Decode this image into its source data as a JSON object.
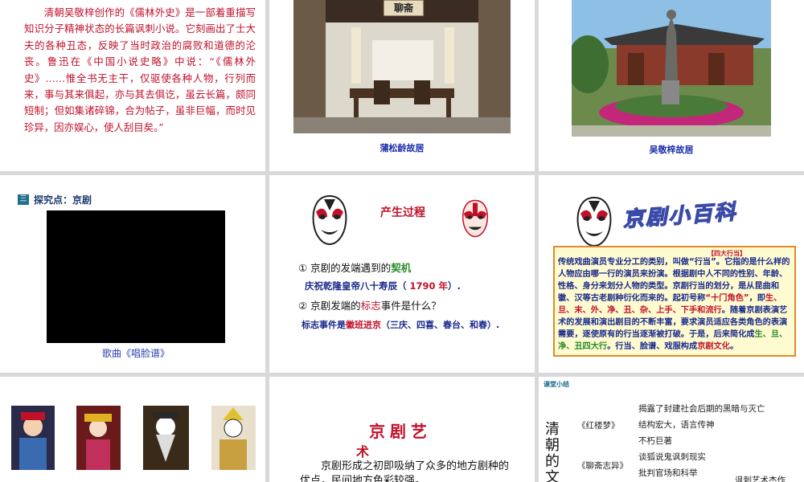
{
  "slide1": {
    "text": "清朝吴敬梓创作的《儒林外史》是一部着重描写知识分子精神状态的长篇讽刺小说。它刻画出了士大夫的各种丑态，反映了当时政治的腐败和道德的沦丧。鲁迅在《中国小说史略》中说：“《儒林外史》……惟全书无主干，仅驱使各种人物，行列而来，事与其来俱起，亦与其去俱讫，虽云长篇，颇同短制；但如集诸碎锦，合为帖子，虽非巨幅，而时见珍异，因亦娱心，使人刮目矣。”"
  },
  "slide2": {
    "plaque": "聊斋",
    "caption": "蒲松龄故居"
  },
  "slide3": {
    "caption": "吴敬梓故居"
  },
  "slide4": {
    "badge": "三",
    "title": "探究点：京剧",
    "video_caption": "歌曲《唱脸谱》"
  },
  "slide5": {
    "title": "产生过程",
    "q1_prefix": "① 京剧的发端遇到的",
    "q1_key": "契机",
    "a1_prefix": "庆祝乾隆皇帝八十寿辰（ ",
    "a1_key": "1790 年",
    "a1_suffix": "）.",
    "q2_prefix": "② 京剧发端的",
    "q2_key": "标志",
    "q2_suffix": "事件是什么？",
    "a2_prefix": "标志事件是",
    "a2_key": "徽班进京",
    "a2_suffix": "（三庆、四喜、春台、和春）."
  },
  "slide6": {
    "wordart": "京剧小百科",
    "tag": "【四大行当】",
    "p1": "传统戏曲演员专业分工的类别，叫做“行当”。它指的是什么样的人物应由哪一行的演员来扮演。根据剧中人不同的性别、年龄、性格、身分来划分人物的类型。京剧行当的划分，是从昆曲和徽、汉等古老剧种衍化而来的。起初号称",
    "k1": "“十门角色”",
    "p2": "，即",
    "k2": "生、旦、末、外、净、丑、杂、上手、下手和流行",
    "p3": "。随着京剧表演艺术的发展和演出剧目的不断丰富，要求演员适应各类角色的表演需要，逐使原有的行当逐渐被打破。于是，后来简化成",
    "k3": "生、旦、净、丑四大行",
    "p4": "。行当、脸谱、戏服构成",
    "k4": "京剧文化",
    "p5": "。"
  },
  "slide8": {
    "title1": "京剧艺",
    "title2": "术",
    "body": "京剧形成之初即吸纳了众多的地方剧种的优点，民间地方色彩较强。"
  },
  "slide9": {
    "tag": "课堂小结",
    "vertical": "清朝的文",
    "book1": "《红楼梦》",
    "book2": "《聊斋志异》",
    "items": [
      "揭露了封建社会后期的黑暗与灭亡",
      "结构宏大，语言传神",
      "不朽巨著",
      "谈狐说鬼讽刺现实",
      "批判官场和科举"
    ],
    "bottom": "讽刺艺术杰作"
  }
}
